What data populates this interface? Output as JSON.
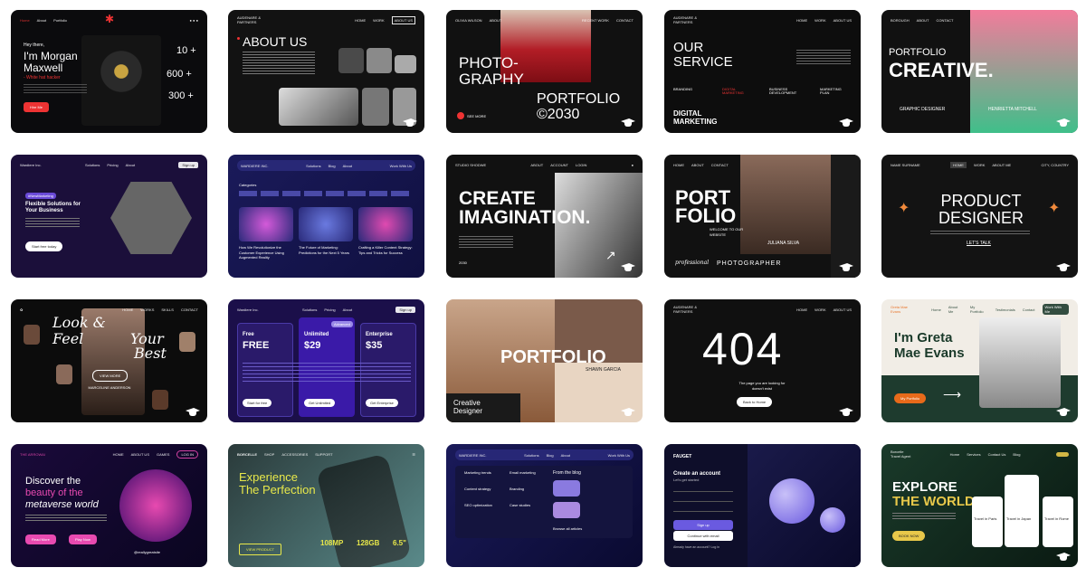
{
  "cards": {
    "c1": {
      "nav": [
        "Home",
        "About",
        "Portfolio"
      ],
      "greet": "Hey there,",
      "name": "I'm Morgan Maxwell",
      "role": "- White hat hacker",
      "stats": [
        "10 +",
        "600 +",
        "300 +"
      ],
      "btn": "Hire Me"
    },
    "c2": {
      "brand": "AUDENARE & PARTNERS",
      "nav": [
        "HOME",
        "WORK",
        "ABOUT US"
      ],
      "title": "ABOUT US"
    },
    "c3": {
      "nav_left": "OLIVIA WILSON",
      "nav_mid": "ABOUT",
      "nav_right": [
        "RECENT WORK",
        "CONTACT"
      ],
      "title": "PHOTO-GRAPHY",
      "subtitle": "PORTFOLIO ©2030",
      "btn": "SEE MORE"
    },
    "c4": {
      "brand": "AUDENARE & PARTNERS",
      "nav": [
        "HOME",
        "WORK",
        "ABOUT US"
      ],
      "title": "OUR SERVICE",
      "items": [
        "BRANDING",
        "DIGITAL MARKETING",
        "BUSINESS DEVELOPMENT",
        "MARKETING PLAN"
      ],
      "footer": "DIGITAL MARKETING"
    },
    "c5": {
      "brand": "BOROUGH",
      "nav": [
        "ABOUT",
        "CONTACT"
      ],
      "title1": "PORTFOLIO",
      "title2": "CREATIVE.",
      "role": "GRAPHIC DESIGNER",
      "name": "HENRIETTA MITCHELL"
    },
    "c6": {
      "brand": "Wardiere Inc.",
      "nav": [
        "Solutions",
        "Pricing",
        "About"
      ],
      "signup": "Sign up",
      "tag": "#NewMarketing",
      "title": "Flexible Solutions for Your Business",
      "btn": "Start free today"
    },
    "c7": {
      "brand": "WARDIERE INC.",
      "nav": [
        "Solutions",
        "Blog",
        "About"
      ],
      "cta": "Work With Us",
      "cat": "Categories",
      "posts": [
        "How We Revolutionize the Customer Experience Using Augmented Reality",
        "The Future of Marketing: Predictions for the Next 5 Years",
        "Crafting a Killer Content Strategy: Tips and Tricks for Success"
      ]
    },
    "c8": {
      "brand": "STUDIO SHODWE",
      "nav": [
        "ABOUT",
        "ACCOUNT",
        "LOGIN"
      ],
      "title": "CREATE IMAGINATION.",
      "year": "2030"
    },
    "c9": {
      "nav": [
        "HOME",
        "ABOUT",
        "CONTACT"
      ],
      "title": "PORT FOLIO",
      "sub": "WELCOME TO OUR WEBSITE",
      "name": "JULIANA SILVA",
      "footer": "PHOTOGRAPHER",
      "script": "professional"
    },
    "c10": {
      "brand": "NAME SURNAME",
      "nav": [
        "HOME",
        "WORK",
        "ABOUT ME"
      ],
      "loc": "CITY, COUNTRY",
      "title": "PRODUCT DESIGNER",
      "btn": "LET'S TALK"
    },
    "c11": {
      "nav": [
        "HOME",
        "WORKS",
        "SKILLS",
        "CONTACT"
      ],
      "title1": "Look &",
      "title2": "Feel",
      "title3": "Your",
      "title4": "Best",
      "btn": "VIEW MORE",
      "name": "ISABEL MERCADO",
      "shop": "MARCELINE ANDERSON"
    },
    "c12": {
      "brand": "Wardiere Inc.",
      "nav": [
        "Solutions",
        "Pricing",
        "About"
      ],
      "signup": "Sign up",
      "plans": [
        {
          "name": "Free",
          "price": "FREE",
          "btn": "Start for free"
        },
        {
          "name": "Unlimited",
          "price": "$29",
          "btn": "Get Unlimited"
        },
        {
          "name": "Enterprise",
          "price": "$35",
          "btn": "Get Enterprise"
        }
      ],
      "badge": "Advanced"
    },
    "c13": {
      "title": "PORTFOLIO",
      "name": "SHAWN GARCIA",
      "footer": "Creative Designer"
    },
    "c14": {
      "brand": "AUDENARE & PARTNERS",
      "nav": [
        "HOME",
        "WORK",
        "ABOUT US"
      ],
      "code": "404",
      "msg": "The page you are looking for doesn't exist",
      "btn": "Back to Home"
    },
    "c15": {
      "brand": "Greta Mae Evans",
      "nav": [
        "Home",
        "About Me",
        "My Portfolio",
        "Testimonials",
        "Contact"
      ],
      "cta": "Work With Me",
      "title": "I'm Greta Mae Evans",
      "btn": "My Portfolio"
    },
    "c16": {
      "brand": "THE ARROWAI",
      "nav": [
        "HOME",
        "ABOUT US",
        "GAMES"
      ],
      "login": "LOG IN",
      "title1": "Discover the",
      "title2": "beauty of the",
      "title3": "metaverse world",
      "btn1": "Read More",
      "btn2": "Play Now",
      "handle": "@reallygreatsite"
    },
    "c17": {
      "brand": "BORCELLE",
      "nav": [
        "SHOP",
        "ACCESSORIES",
        "SUPPORT"
      ],
      "title": "Experience The Perfection",
      "btn": "VIEW PRODUCT",
      "specs": [
        "108MP",
        "128GB",
        "6.5\""
      ]
    },
    "c18": {
      "brand": "WARDIERE INC.",
      "nav": [
        "Solutions",
        "Blog",
        "About"
      ],
      "cta": "Work With Us",
      "menu": [
        "Marketing trends",
        "Email marketing",
        "Content strategy",
        "Branding",
        "SEO optimization",
        "Case studies"
      ],
      "blog": "From the blog",
      "browse": "Browse all articles"
    },
    "c19": {
      "brand": "FAUGET",
      "title": "Create an account",
      "sub": "Let's get started",
      "btn1": "Sign up",
      "btn2": "Continue with email",
      "login": "Already have an account? Log in"
    },
    "c20": {
      "brand": "Borcelle Travel Agent",
      "nav": [
        "Home",
        "Services",
        "Contact Us",
        "Blog"
      ],
      "title1": "EXPLORE",
      "title2": "THE WORLD",
      "btn": "BOOK NOW",
      "cards": [
        "Travel in Paris",
        "Travel in Japan",
        "Travel in Rome"
      ]
    }
  }
}
